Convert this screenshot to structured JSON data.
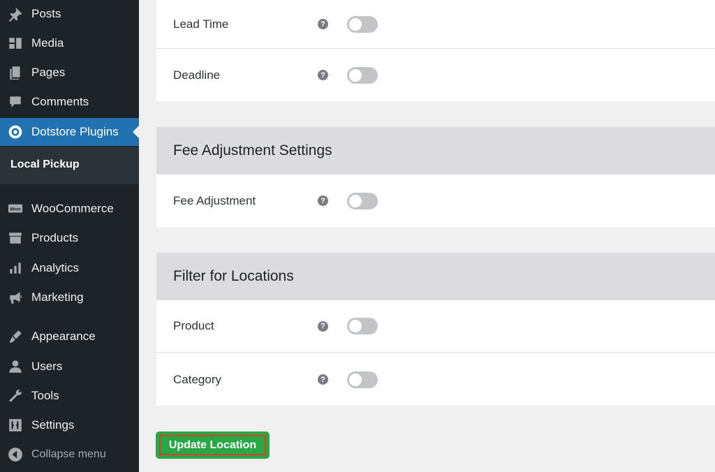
{
  "sidebar": {
    "items": [
      {
        "label": "Posts",
        "icon": "pin-icon"
      },
      {
        "label": "Media",
        "icon": "media-icon"
      },
      {
        "label": "Pages",
        "icon": "pages-icon"
      },
      {
        "label": "Comments",
        "icon": "comment-icon"
      },
      {
        "label": "Dotstore Plugins",
        "icon": "dotstore-icon",
        "active": true
      },
      {
        "label": "WooCommerce",
        "icon": "woo-icon"
      },
      {
        "label": "Products",
        "icon": "archive-icon"
      },
      {
        "label": "Analytics",
        "icon": "bar-chart-icon"
      },
      {
        "label": "Marketing",
        "icon": "megaphone-icon"
      },
      {
        "label": "Appearance",
        "icon": "brush-icon"
      },
      {
        "label": "Users",
        "icon": "user-icon"
      },
      {
        "label": "Tools",
        "icon": "wrench-icon"
      },
      {
        "label": "Settings",
        "icon": "settings-sliders-icon"
      }
    ],
    "submenu_label": "Local Pickup",
    "collapse_label": "Collapse menu"
  },
  "sections": {
    "top": {
      "rows": [
        "Lead Time",
        "Deadline"
      ]
    },
    "fee": {
      "title": "Fee Adjustment Settings",
      "rows": [
        "Fee Adjustment"
      ]
    },
    "filter": {
      "title": "Filter for Locations",
      "rows": [
        "Product",
        "Category"
      ]
    }
  },
  "help_glyph": "?",
  "update_button_label": "Update Location",
  "colors": {
    "sidebar_bg": "#1d2327",
    "active_bg": "#2271b1",
    "button_green": "#28a745",
    "highlight_red": "#e03b2f"
  }
}
